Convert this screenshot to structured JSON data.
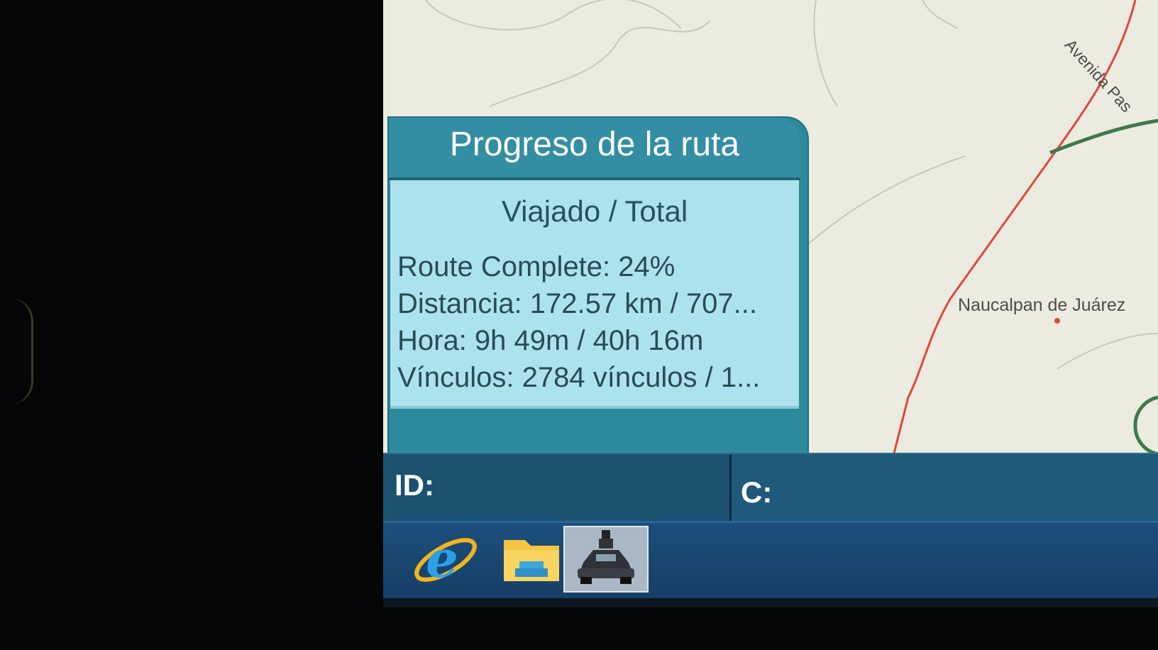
{
  "map": {
    "city_label": "Naucalpan de Juárez",
    "street_label": "Avenida Pas",
    "route_color": "#e0463c",
    "road_color": "#3e7a4a"
  },
  "route_progress_panel": {
    "title": "Progreso de la ruta",
    "column_header": "Viajado / Total",
    "route_complete": "Route Complete: 24%",
    "distance": "Distancia: 172.57 km / 707...",
    "time": "Hora: 9h 49m / 40h 16m",
    "links": "Vínculos: 2784 vínculos / 1...",
    "complete_percent": 24
  },
  "status_bar": {
    "id_label": "ID:",
    "c_label": "C:"
  },
  "taskbar": {
    "apps": [
      "internet-explorer-icon",
      "file-explorer-icon",
      "navigation-car-icon"
    ]
  },
  "colors": {
    "panel_header": "#348ea3",
    "panel_body": "#ace2ee",
    "status_bar": "#1f5a7a",
    "taskbar": "#1d4e7c"
  }
}
